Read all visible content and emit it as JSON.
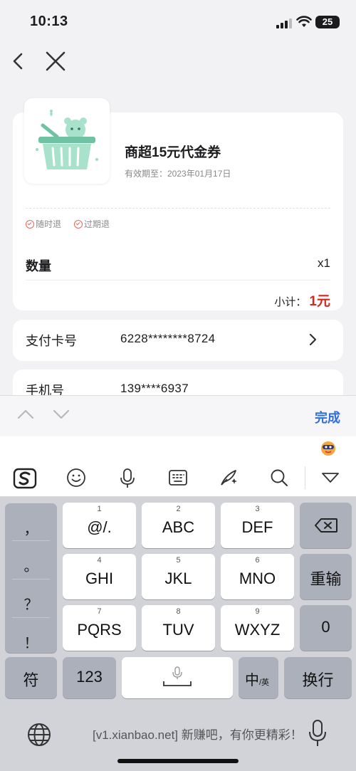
{
  "status": {
    "time": "10:13",
    "battery": "25"
  },
  "product": {
    "title": "商超15元代金券",
    "expiry": "有效期至：2023年01月17日",
    "tags": [
      "随时退",
      "过期退"
    ],
    "quantity_label": "数量",
    "quantity_value": "x1",
    "subtotal_label": "小计：",
    "subtotal_amount": "1元"
  },
  "payment_card": {
    "label": "支付卡号",
    "value": "6228********8724"
  },
  "phone": {
    "label": "手机号",
    "value": "139****6937"
  },
  "accessory": {
    "done": "完成"
  },
  "keyboard": {
    "punct": [
      "，",
      "。",
      "？",
      "！"
    ],
    "rows": [
      [
        {
          "num": "1",
          "label": "@/."
        },
        {
          "num": "2",
          "label": "ABC"
        },
        {
          "num": "3",
          "label": "DEF"
        }
      ],
      [
        {
          "num": "4",
          "label": "GHI"
        },
        {
          "num": "5",
          "label": "JKL"
        },
        {
          "num": "6",
          "label": "MNO"
        }
      ],
      [
        {
          "num": "7",
          "label": "PQRS"
        },
        {
          "num": "8",
          "label": "TUV"
        },
        {
          "num": "9",
          "label": "WXYZ"
        }
      ]
    ],
    "retype": "重输",
    "zero": "0",
    "symbols": "符",
    "numeric": "123",
    "lang_main": "中",
    "lang_sub": "/英",
    "enter": "换行"
  },
  "watermark": "[v1.xianbao.net] 新赚吧，有你更精彩！",
  "colors": {
    "accent": "#2f6fd6",
    "price": "#d7261b",
    "tag": "#e8675b"
  }
}
